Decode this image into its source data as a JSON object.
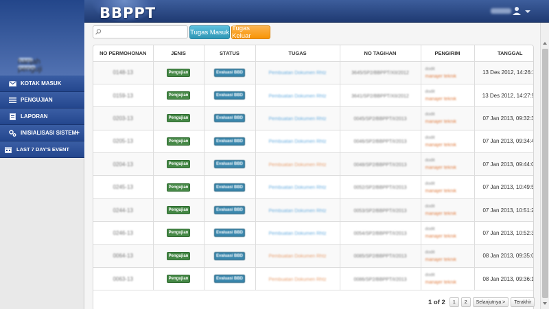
{
  "header": {
    "logo": "BBPPT",
    "user_name": "hanjah"
  },
  "sidebar": {
    "profile_lines": [
      "hanjah",
      "penguji"
    ],
    "items": [
      {
        "label": "KOTAK MASUK",
        "icon": "envelope-icon"
      },
      {
        "label": "PENGUJIAN",
        "icon": "list-icon"
      },
      {
        "label": "LAPORAN",
        "icon": "document-icon"
      },
      {
        "label": "INISIALISASI SISTEM",
        "icon": "gears-icon",
        "expand": "+"
      },
      {
        "label": "LAST 7 DAY'S EVENT",
        "icon": "calendar-icon"
      }
    ]
  },
  "toolbar": {
    "search_placeholder": "",
    "tugas_masuk": "Tugas Masuk",
    "tugas_keluar": "Tugas Keluar"
  },
  "table": {
    "columns": [
      "NO PERMOHONAN",
      "JENIS",
      "STATUS",
      "TUGAS",
      "NO TAGIHAN",
      "PENGIRIM",
      "TANGGAL"
    ],
    "rows": [
      {
        "no": "0148-13",
        "jenis": "Pengujian",
        "status": "Evaluasi BBD",
        "tugas": "Pembuatan Dokumen Rhtz",
        "tugas_color": "#6aaee0",
        "tagihan": "3645/SP2/BBPPT/XII/2012",
        "pengirim": "dodit",
        "role": "manajer teknik",
        "tanggal": "13 Des 2012, 14:26:11"
      },
      {
        "no": "0159-13",
        "jenis": "Pengujian",
        "status": "Evaluasi BBD",
        "tugas": "Pembuatan Dokumen Rhtz",
        "tugas_color": "#6aaee0",
        "tagihan": "3641/SP2/BBPPT/XII/2012",
        "pengirim": "dodit",
        "role": "manajer teknik",
        "tanggal": "13 Des 2012, 14:27:54"
      },
      {
        "no": "0203-13",
        "jenis": "Pengujian",
        "status": "Evaluasi BBD",
        "tugas": "Pembuatan Dokumen Rhtz",
        "tugas_color": "#6aaee0",
        "tagihan": "0045/SP2/BBPPT/I/2013",
        "pengirim": "dodit",
        "role": "manajer teknik",
        "tanggal": "07 Jan 2013, 09:32:38"
      },
      {
        "no": "0205-13",
        "jenis": "Pengujian",
        "status": "Evaluasi BBD",
        "tugas": "Pembuatan Dokumen Rhtz",
        "tugas_color": "#6aaee0",
        "tagihan": "0046/SP2/BBPPT/I/2013",
        "pengirim": "dodit",
        "role": "manajer teknik",
        "tanggal": "07 Jan 2013, 09:34:45"
      },
      {
        "no": "0204-13",
        "jenis": "Pengujian",
        "status": "Evaluasi BBD",
        "tugas": "Pembuatan Dokumen Rhtz",
        "tugas_color": "#e8a070",
        "tagihan": "0048/SP2/BBPPT/I/2013",
        "pengirim": "dodit",
        "role": "manajer teknik",
        "tanggal": "07 Jan 2013, 09:44:07"
      },
      {
        "no": "0245-13",
        "jenis": "Pengujian",
        "status": "Evaluasi BBD",
        "tugas": "Pembuatan Dokumen Rhtz",
        "tugas_color": "#6aaee0",
        "tagihan": "0052/SP2/BBPPT/I/2013",
        "pengirim": "dodit",
        "role": "manajer teknik",
        "tanggal": "07 Jan 2013, 10:49:56"
      },
      {
        "no": "0244-13",
        "jenis": "Pengujian",
        "status": "Evaluasi BBD",
        "tugas": "Pembuatan Dokumen Rhtz",
        "tugas_color": "#6aaee0",
        "tagihan": "0053/SP2/BBPPT/I/2013",
        "pengirim": "dodit",
        "role": "manajer teknik",
        "tanggal": "07 Jan 2013, 10:51:20"
      },
      {
        "no": "0246-13",
        "jenis": "Pengujian",
        "status": "Evaluasi BBD",
        "tugas": "Pembuatan Dokumen Rhtz",
        "tugas_color": "#6aaee0",
        "tagihan": "0054/SP2/BBPPT/I/2013",
        "pengirim": "dodit",
        "role": "manajer teknik",
        "tanggal": "07 Jan 2013, 10:52:35"
      },
      {
        "no": "0064-13",
        "jenis": "Pengujian",
        "status": "Evaluasi BBD",
        "tugas": "Pembuatan Dokumen Rhtz",
        "tugas_color": "#e8a070",
        "tagihan": "0085/SP2/BBPPT/I/2013",
        "pengirim": "dodit",
        "role": "manajer teknik",
        "tanggal": "08 Jan 2013, 09:35:00"
      },
      {
        "no": "0063-13",
        "jenis": "Pengujian",
        "status": "Evaluasi BBD",
        "tugas": "Pembuatan Dokumen Rhtz",
        "tugas_color": "#e8a070",
        "tagihan": "0086/SP2/BBPPT/I/2013",
        "pengirim": "dodit",
        "role": "manajer teknik",
        "tanggal": "08 Jan 2013, 09:36:16"
      }
    ]
  },
  "pagination": {
    "info": "1 of 2",
    "pages": [
      "1",
      "2"
    ],
    "next": "Selanjutnya >",
    "last": "Terakhir"
  },
  "colors": {
    "header_blue": "#2c4a87",
    "badge_green": "#468847",
    "badge_blue": "#3a87ad",
    "btn_info": "#49afcd",
    "btn_warning": "#faa732"
  }
}
